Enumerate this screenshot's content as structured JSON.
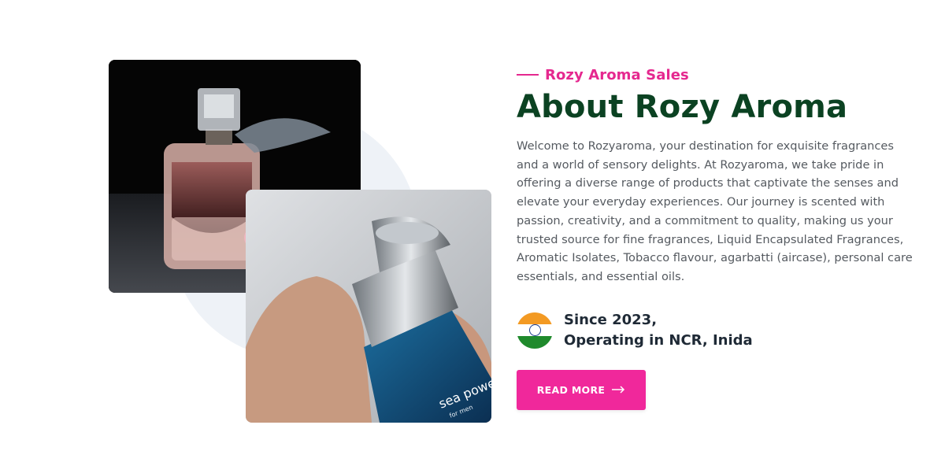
{
  "about": {
    "subtitle": "Rozy Aroma Sales",
    "title": "About Rozy Aroma",
    "description": "Welcome to Rozyaroma, your destination for exquisite fragrances and a world of sensory delights. At Rozyaroma, we take pride in offering a diverse range of products that captivate the senses and elevate your everyday experiences. Our journey is scented with passion, creativity, and a commitment to quality, making us your trusted source for fine fragrances, Liquid Encapsulated Fragrances, Aromatic Isolates, Tobacco flavour, agarbatti (aircase), personal care essentials, and essential oils.",
    "since_line1": "Since 2023,",
    "since_line2": "Operating in NCR, Inida",
    "flag_icon": "india-flag-icon",
    "button_label": "READ MORE",
    "button_icon": "arrow-right-icon"
  },
  "images": {
    "main": "perfume-bottle-with-flowers",
    "secondary": "hand-holding-sea-power-bottle",
    "bottle_text_line1": "sea power",
    "bottle_text_line2": "for men"
  },
  "colors": {
    "accent": "#e5288f",
    "title": "#0b4222",
    "button": "#f0289b",
    "text": "#555a60"
  }
}
